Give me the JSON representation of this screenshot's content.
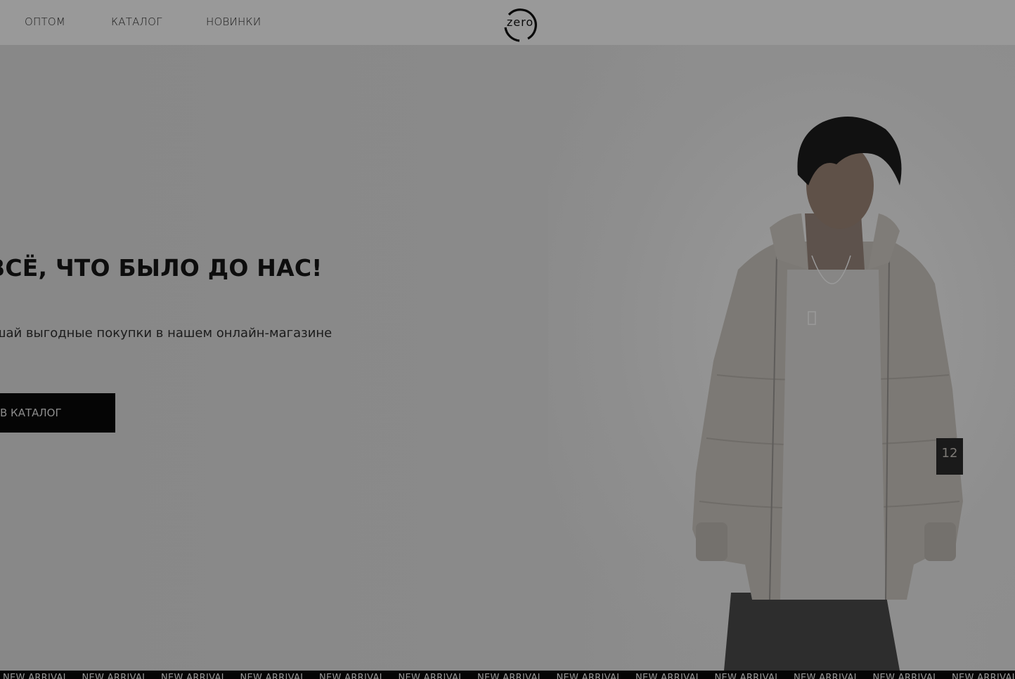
{
  "header": {
    "nav": [
      {
        "label": "ОПТОМ"
      },
      {
        "label": "КАТАЛОГ"
      },
      {
        "label": "НОВИНКИ"
      }
    ],
    "logo_text": "zero"
  },
  "hero": {
    "title": "ВСЁ, ЧТО БЫЛО ДО НАС!",
    "subtitle": "шай выгодные покупки в нашем онлайн-магазине",
    "button_label": "В КАТАЛОГ",
    "patch_text": "12"
  },
  "marquee": {
    "items": [
      "NEW ARRIVAL",
      "NEW ARRIVAL",
      "NEW ARRIVAL",
      "NEW ARRIVAL",
      "NEW ARRIVAL",
      "NEW ARRIVAL",
      "NEW ARRIVAL",
      "NEW ARRIVAL",
      "NEW ARRIVAL",
      "NEW ARRIVAL",
      "NEW ARRIVAL",
      "NEW ARRIVAL",
      "NEW ARRIVAL"
    ]
  },
  "colors": {
    "overlay": "#8c8c8c",
    "header": "#999999",
    "button": "#050505",
    "marquee": "#050505"
  }
}
